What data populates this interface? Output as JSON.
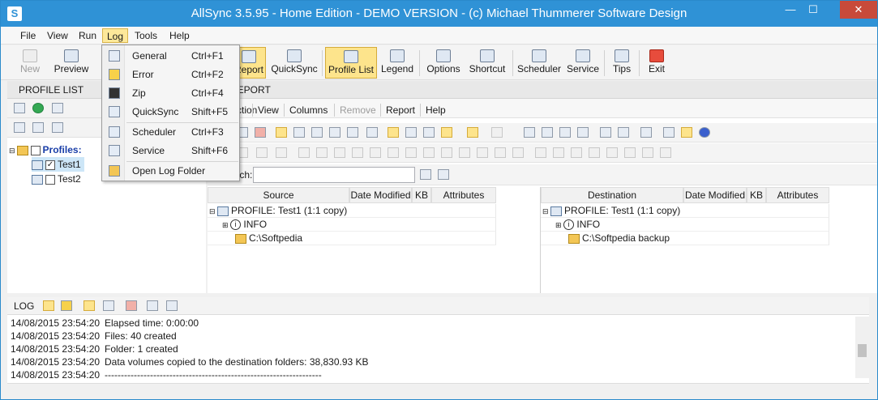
{
  "window": {
    "title": "AllSync 3.5.95 - Home Edition - DEMO VERSION - (c) Michael Thummerer Software Design",
    "minimize_glyph": "—",
    "maximize_glyph": "☐",
    "close_glyph": "✕"
  },
  "menubar": [
    "File",
    "View",
    "Run",
    "Log",
    "Tools",
    "Help"
  ],
  "toolbar": {
    "new": "New",
    "preview": "Preview",
    "report": "Report",
    "quicksync": "QuickSync",
    "profile_list": "Profile List",
    "legend": "Legend",
    "options": "Options",
    "shortcut": "Shortcut",
    "scheduler": "Scheduler",
    "service": "Service",
    "tips": "Tips",
    "exit": "Exit"
  },
  "log_menu": {
    "items": [
      {
        "label": "General",
        "shortcut": "Ctrl+F1"
      },
      {
        "label": "Error",
        "shortcut": "Ctrl+F2"
      },
      {
        "label": "Zip",
        "shortcut": "Ctrl+F4"
      },
      {
        "label": "QuickSync",
        "shortcut": "Shift+F5"
      },
      {
        "label": "Scheduler",
        "shortcut": "Ctrl+F3"
      },
      {
        "label": "Service",
        "shortcut": "Shift+F6"
      },
      {
        "label": "Open Log Folder",
        "shortcut": ""
      }
    ]
  },
  "profile_list": {
    "header": "PROFILE LIST",
    "root": "Profiles:",
    "items": [
      "Test1",
      "Test2"
    ]
  },
  "report": {
    "header": "REPORT",
    "menu": [
      "Action",
      "View",
      "Columns",
      "Remove",
      "Report",
      "Help"
    ],
    "search_label": "Search:",
    "search_value": "",
    "source": {
      "headers": [
        "Source",
        "Date Modified",
        "KB",
        "Attributes"
      ],
      "profile": "PROFILE: Test1   (1:1 copy)",
      "info": "INFO",
      "folder": "C:\\Softpedia"
    },
    "destination": {
      "headers": [
        "Destination",
        "Date Modified",
        "KB",
        "Attributes"
      ],
      "profile": "PROFILE: Test1   (1:1 copy)",
      "info": "INFO",
      "folder": "C:\\Softpedia backup"
    }
  },
  "log": {
    "header": "LOG",
    "entries": [
      {
        "time": "14/08/2015 23:54:20",
        "text": "Elapsed time: 0:00:00"
      },
      {
        "time": "14/08/2015 23:54:20",
        "text": "Files: 40 created"
      },
      {
        "time": "14/08/2015 23:54:20",
        "text": "Folder: 1 created"
      },
      {
        "time": "14/08/2015 23:54:20",
        "text": "Data volumes copied to the destination folders: 38,830.93 KB"
      },
      {
        "time": "14/08/2015 23:54:20",
        "text": "-------------------------------------------------------------------"
      }
    ]
  },
  "colors": {
    "titlebar": "#2f92d6",
    "highlight": "#fde48c"
  }
}
